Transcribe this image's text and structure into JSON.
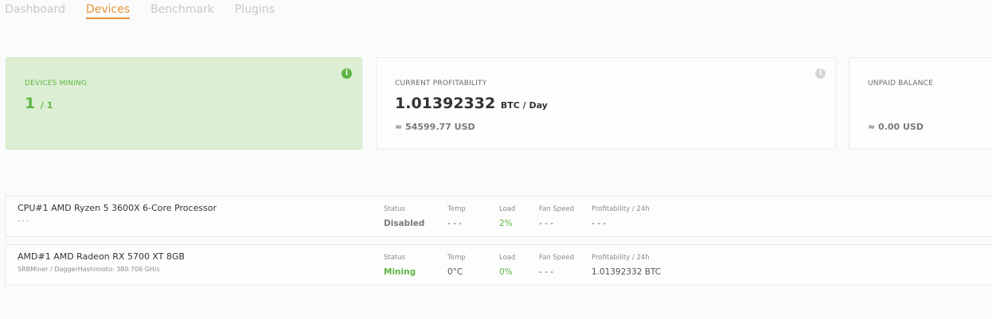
{
  "tabs": [
    {
      "label": "Dashboard",
      "active": false
    },
    {
      "label": "Devices",
      "active": true
    },
    {
      "label": "Benchmark",
      "active": false
    },
    {
      "label": "Plugins",
      "active": false
    }
  ],
  "cards": {
    "devices_mining": {
      "title": "DEVICES MINING",
      "count": "1",
      "total": "/ 1"
    },
    "profitability": {
      "title": "CURRENT PROFITABILITY",
      "value": "1.01392332",
      "unit": "BTC / Day",
      "usd": "≈ 54599.77 USD"
    },
    "unpaid": {
      "title": "UNPAID BALANCE",
      "usd": "≈ 0.00 USD"
    }
  },
  "labels": {
    "status": "Status",
    "temp": "Temp",
    "load": "Load",
    "fan_speed": "Fan Speed",
    "profitability": "Profitability / 24h"
  },
  "devices": [
    {
      "name": "CPU#1 AMD Ryzen 5 3600X 6-Core Processor",
      "sub": "- - -",
      "status": "Disabled",
      "temp": "- - -",
      "load": "2%",
      "fan": "- - -",
      "profit": "- - -"
    },
    {
      "name": "AMD#1 AMD Radeon RX 5700 XT 8GB",
      "sub": "SRBMiner / DaggerHashimoto: 380.706 GH/s",
      "status": "Mining",
      "temp": "0°C",
      "load": "0%",
      "fan": "- - -",
      "profit": "1.01392332 BTC"
    }
  ],
  "colors": {
    "accent": "#e8923a",
    "green": "#5fb544",
    "green_bg": "#dcefd4"
  },
  "icons": {
    "info": "info-icon"
  }
}
